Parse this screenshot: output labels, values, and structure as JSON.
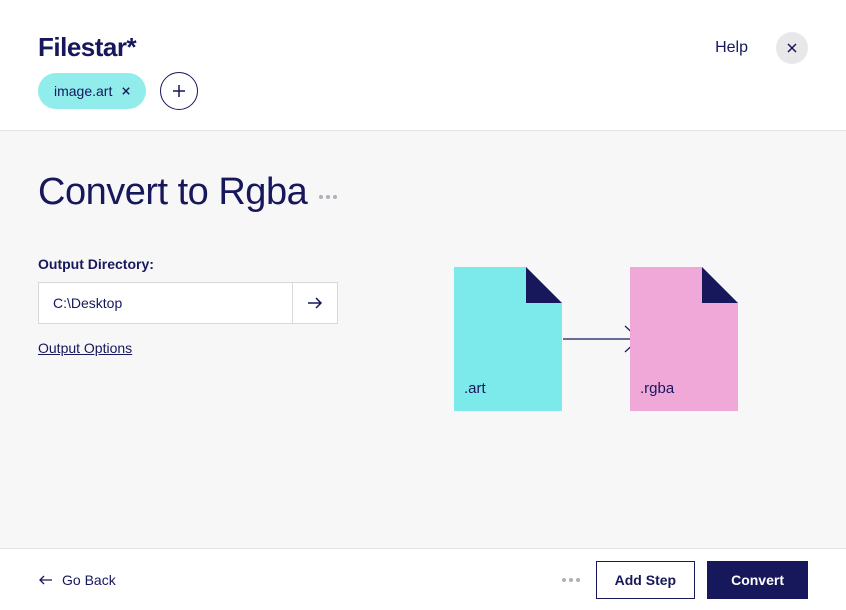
{
  "header": {
    "logo": "Filestar*",
    "help": "Help"
  },
  "fileChips": {
    "items": [
      {
        "label": "image.art"
      }
    ]
  },
  "main": {
    "title": "Convert to Rgba",
    "outputDirLabel": "Output Directory:",
    "outputDirValue": "C:\\Desktop",
    "outputOptions": "Output Options"
  },
  "diagram": {
    "sourceExt": ".art",
    "targetExt": ".rgba"
  },
  "footer": {
    "goBack": "Go Back",
    "addStep": "Add Step",
    "convert": "Convert"
  }
}
